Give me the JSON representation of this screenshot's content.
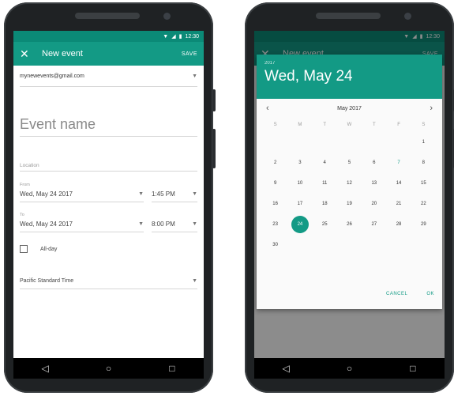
{
  "colors": {
    "accent": "#139a85",
    "status_bar": "#0b8a77"
  },
  "status": {
    "time": "12:30"
  },
  "left": {
    "app_bar": {
      "close_icon": "close-icon",
      "title": "New event",
      "save": "SAVE"
    },
    "account": "mynewevents@gmail.com",
    "event_name_placeholder": "Event name",
    "location_placeholder": "Location",
    "from_label": "From",
    "from_date": "Wed, May 24 2017",
    "from_time": "1:45 PM",
    "to_label": "To",
    "to_date": "Wed, May 24 2017",
    "to_time": "8:00 PM",
    "all_day": "All-day",
    "timezone": "Pacific Standard Time"
  },
  "right": {
    "app_bar": {
      "title": "New event",
      "save": "SAVE"
    },
    "dialog": {
      "year": "2017",
      "date": "Wed, May 24",
      "month": "May 2017",
      "weekdays": [
        "S",
        "M",
        "T",
        "W",
        "T",
        "F",
        "S"
      ],
      "selected": "24",
      "today": "7",
      "cancel": "CANCEL",
      "ok": "OK"
    }
  }
}
